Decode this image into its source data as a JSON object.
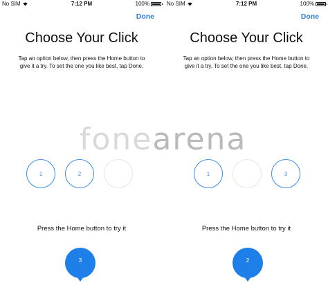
{
  "screens": [
    {
      "status": {
        "carrier": "No SIM",
        "time": "7:12 PM",
        "battery": "100%"
      },
      "done_label": "Done",
      "title": "Choose Your Click",
      "description": "Tap an option below, then press the Home button to give it a try. To set the one you like best, tap Done.",
      "options": [
        "1",
        "2",
        ""
      ],
      "prompt": "Press the Home button to try it",
      "bubble_value": "3"
    },
    {
      "status": {
        "carrier": "No SIM",
        "time": "7:12 PM",
        "battery": "100%"
      },
      "done_label": "Done",
      "title": "Choose Your Click",
      "description": "Tap an option below, then press the Home button to give it a try. To set the one you like best, tap Done.",
      "options": [
        "1",
        "",
        "3"
      ],
      "prompt": "Press the Home button to try it",
      "bubble_value": "2"
    }
  ],
  "watermark": {
    "part1": "fone",
    "part2": "arena"
  },
  "colors": {
    "accent": "#2f80e0",
    "circle_border": "#3a8ee8",
    "bubble": "#1f7fe8"
  },
  "icons": {
    "wifi": "wifi-icon",
    "battery": "battery-icon"
  }
}
